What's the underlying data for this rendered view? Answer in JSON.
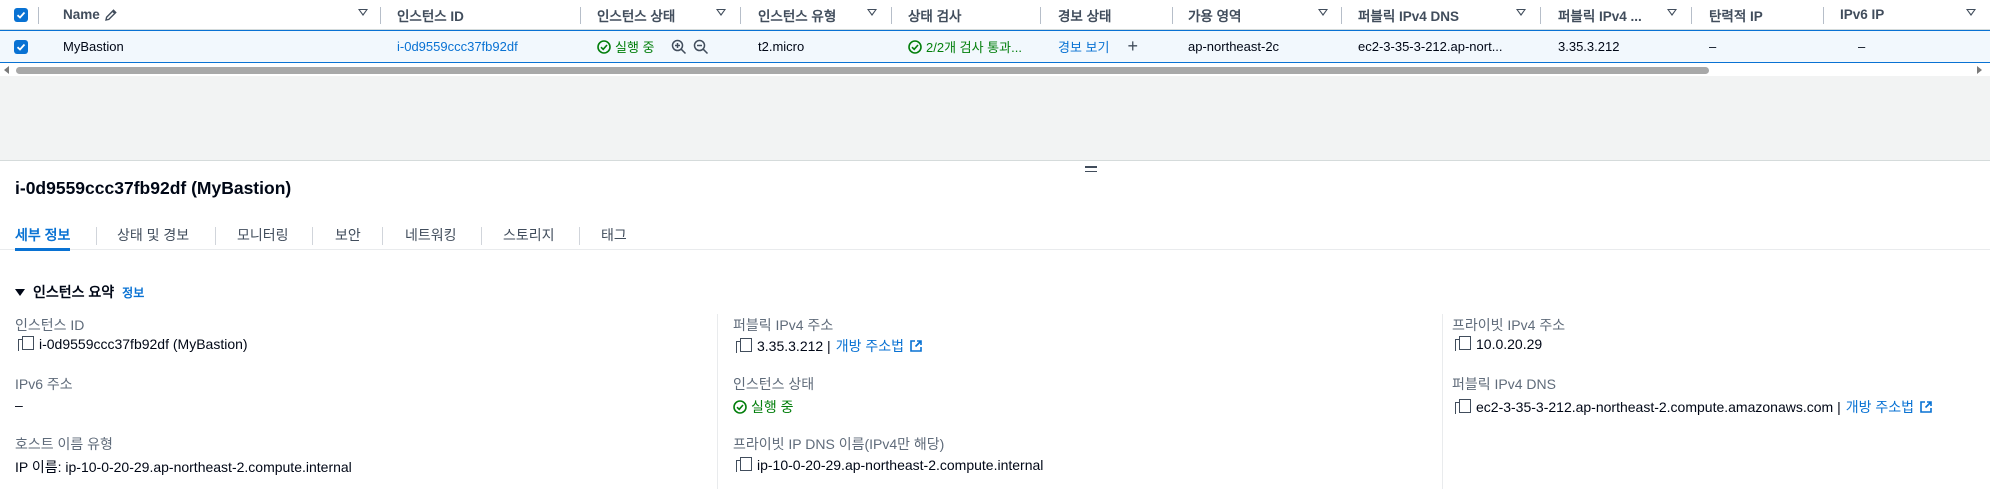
{
  "table": {
    "headers": {
      "name": "Name",
      "instance_id": "인스턴스 ID",
      "instance_state": "인스턴스 상태",
      "instance_type": "인스턴스 유형",
      "status_check": "상태 검사",
      "alarm_status": "경보 상태",
      "availability_zone": "가용 영역",
      "public_dns": "퍼블릭 IPv4 DNS",
      "public_ipv4": "퍼블릭 IPv4 ...",
      "elastic_ip": "탄력적 IP",
      "ipv6_ip": "IPv6 IP"
    },
    "row": {
      "name": "MyBastion",
      "instance_id": "i-0d9559ccc37fb92df",
      "instance_state": "실행 중",
      "instance_type": "t2.micro",
      "status_check": "2/2개 검사 통과...",
      "alarm_status": "경보 보기",
      "alarm_add": "+",
      "availability_zone": "ap-northeast-2c",
      "public_dns": "ec2-3-35-3-212.ap-nort...",
      "public_ipv4": "3.35.3.212",
      "elastic_ip": "–",
      "ipv6_ip": "–"
    }
  },
  "detail": {
    "title": "i-0d9559ccc37fb92df (MyBastion)",
    "tabs": [
      "세부 정보",
      "상태 및 경보",
      "모니터링",
      "보안",
      "네트워킹",
      "스토리지",
      "태그"
    ],
    "section_title": "인스턴스 요약",
    "info_link": "정보",
    "fields": {
      "instance_id_label": "인스턴스 ID",
      "instance_id_value": "i-0d9559ccc37fb92df (MyBastion)",
      "ipv6_label": "IPv6 주소",
      "ipv6_value": "–",
      "hostname_type_label": "호스트 이름 유형",
      "hostname_type_value": "IP 이름: ip-10-0-20-29.ap-northeast-2.compute.internal",
      "public_ipv4_label": "퍼블릭 IPv4 주소",
      "public_ipv4_value": "3.35.3.212 |",
      "public_ipv4_open": "개방 주소법",
      "instance_state_label": "인스턴스 상태",
      "instance_state_value": "실행 중",
      "private_dns_label": "프라이빗 IP DNS 이름(IPv4만 해당)",
      "private_dns_value": "ip-10-0-20-29.ap-northeast-2.compute.internal",
      "private_ipv4_label": "프라이빗 IPv4 주소",
      "private_ipv4_value": "10.0.20.29",
      "public_dns_label": "퍼블릭 IPv4 DNS",
      "public_dns_value": "ec2-3-35-3-212.ap-northeast-2.compute.amazonaws.com |",
      "public_dns_open": "개방 주소법"
    }
  },
  "colors": {
    "accent": "#0972d3",
    "success": "#037f0c",
    "selected_row_bg": "#f2f8fd",
    "empty_area_bg": "#f2f3f3"
  },
  "icons": [
    "checkbox-checked-icon",
    "edit-pencil-icon",
    "sort-caret-icon",
    "status-ok-icon",
    "zoom-in-icon",
    "zoom-out-icon",
    "add-icon",
    "copy-icon",
    "external-link-icon",
    "expand-triangle-icon",
    "resize-grip-icon"
  ]
}
